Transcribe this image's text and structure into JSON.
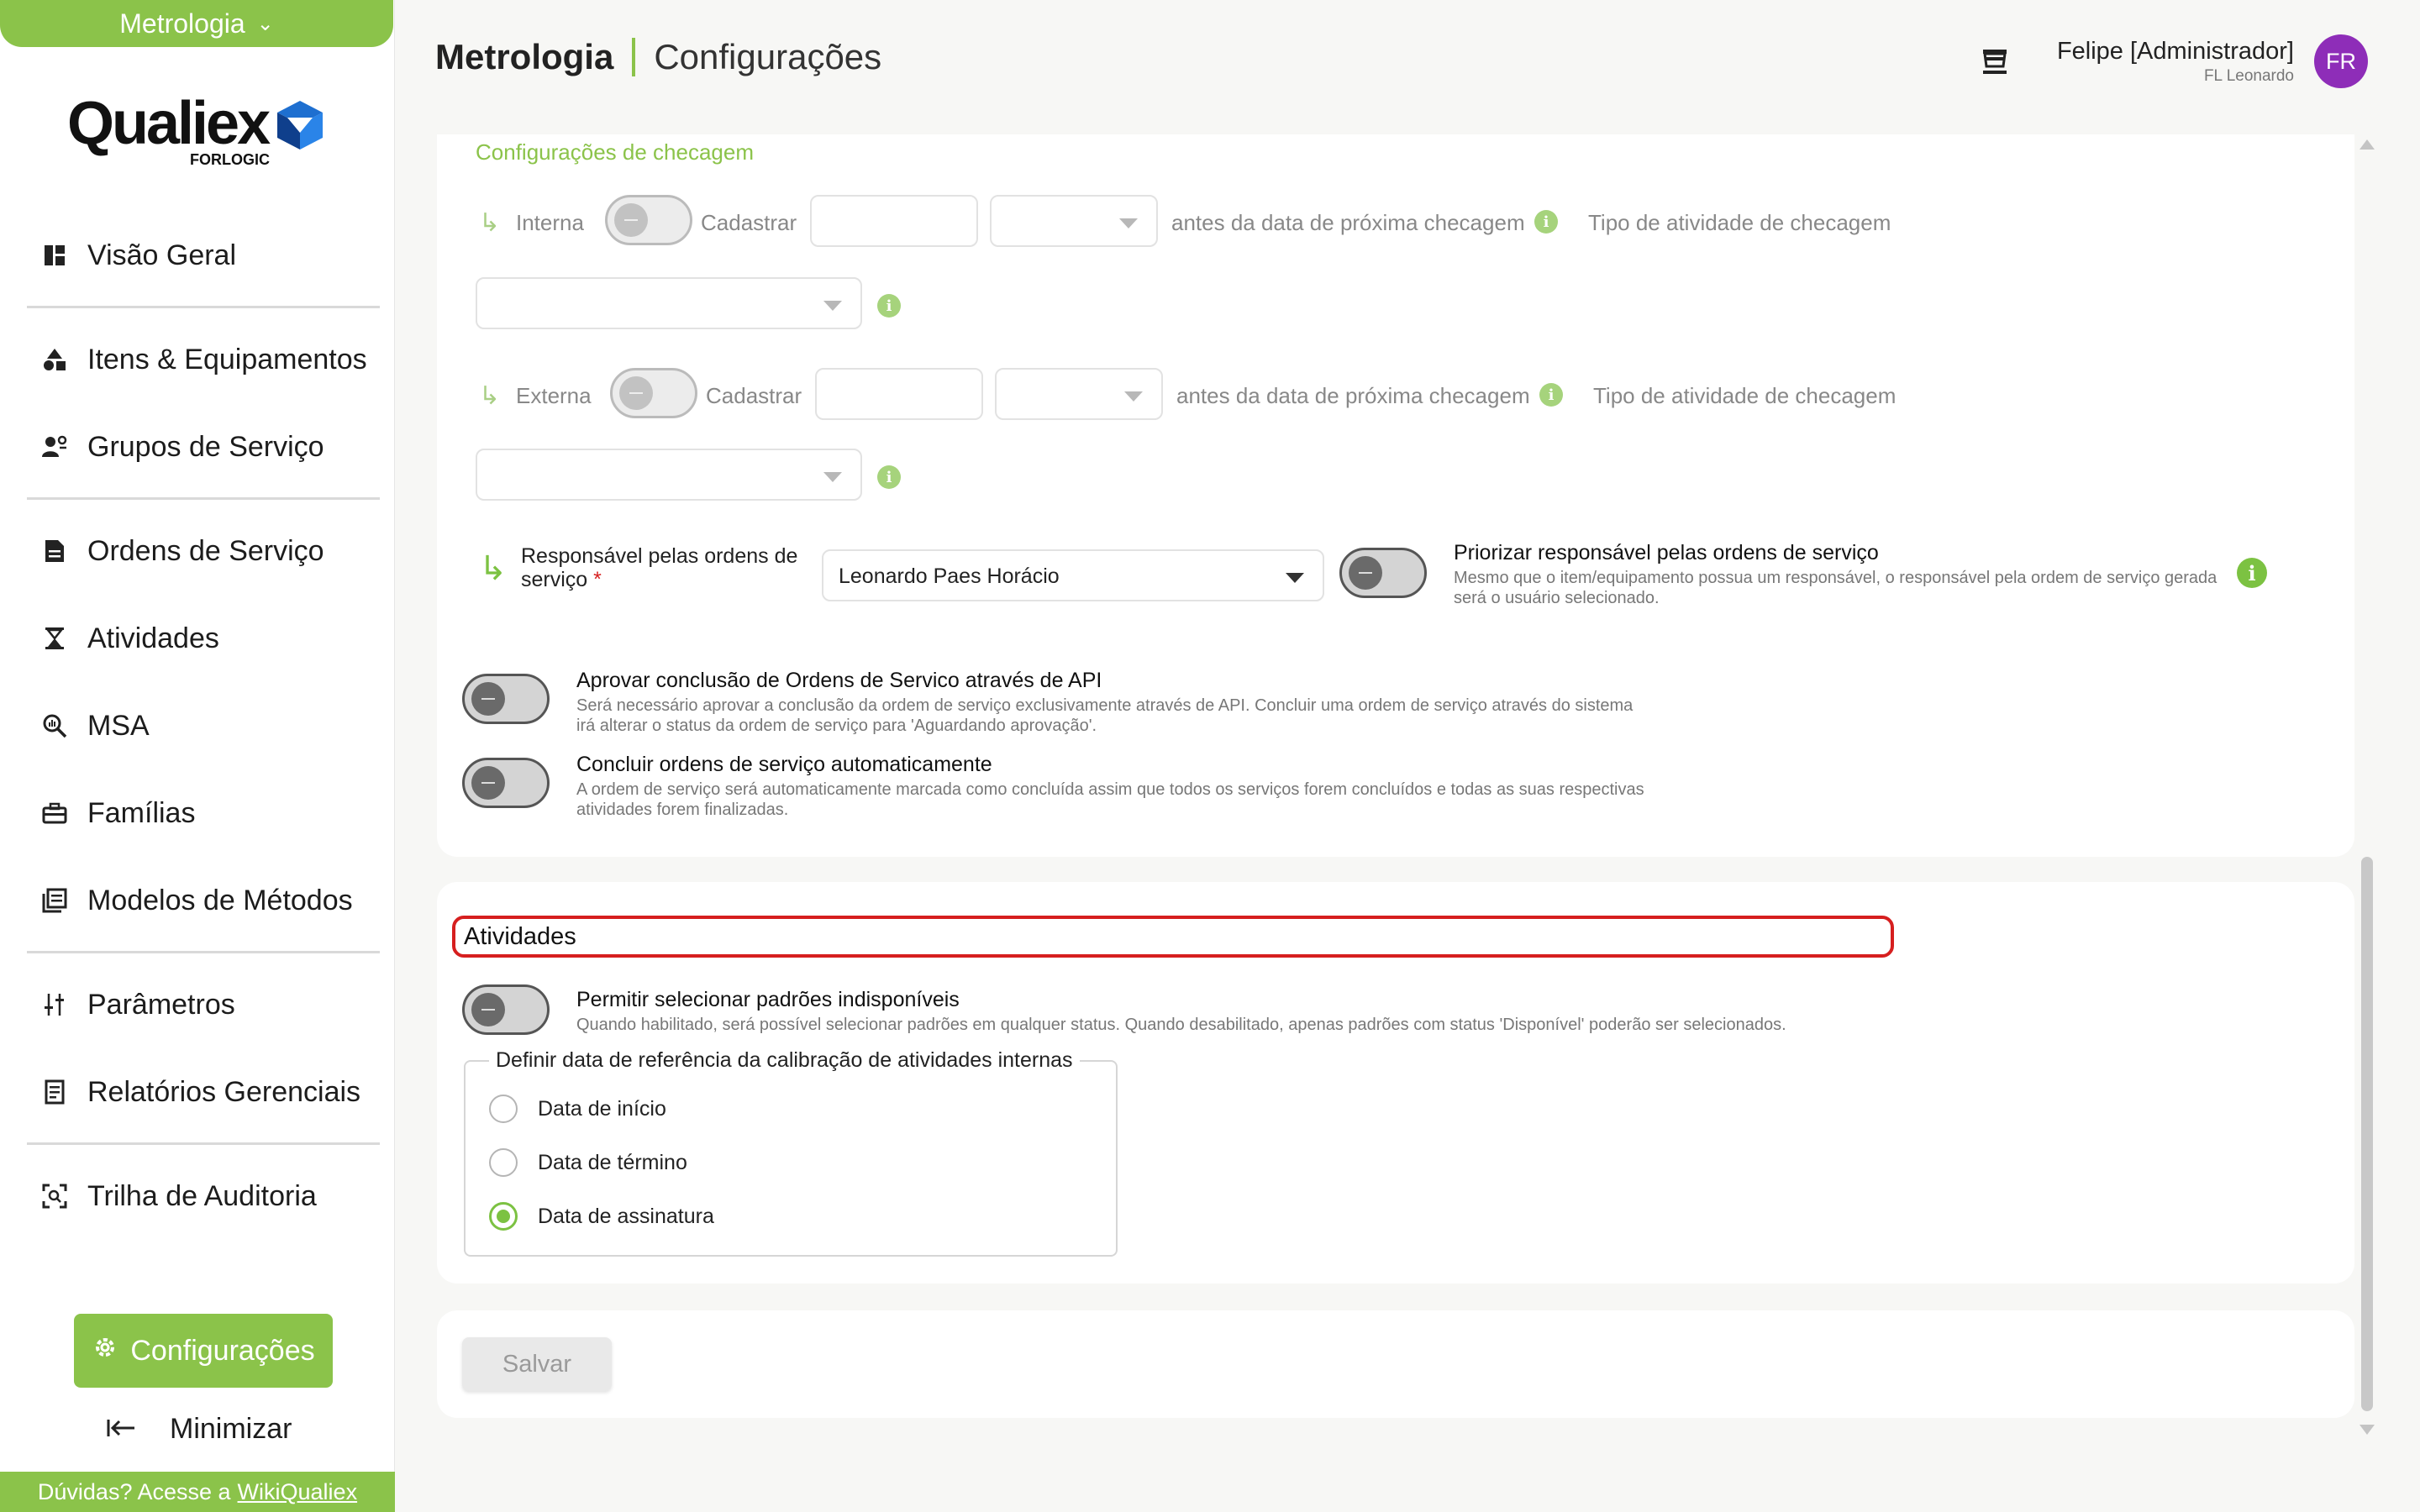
{
  "sidebar": {
    "module": "Metrologia",
    "logo": {
      "name": "Qualiex",
      "sub": "FORLOGIC"
    },
    "items": [
      {
        "label": "Visão Geral",
        "icon": "dashboard-icon"
      },
      {
        "label": "Itens & Equipamentos",
        "icon": "shapes-icon"
      },
      {
        "label": "Grupos de Serviço",
        "icon": "group-icon"
      },
      {
        "label": "Ordens de Serviço",
        "icon": "document-icon"
      },
      {
        "label": "Atividades",
        "icon": "hourglass-icon"
      },
      {
        "label": "MSA",
        "icon": "magnify-chart-icon"
      },
      {
        "label": "Famílias",
        "icon": "toolbox-icon"
      },
      {
        "label": "Modelos de Métodos",
        "icon": "library-icon"
      },
      {
        "label": "Parâmetros",
        "icon": "sliders-icon"
      },
      {
        "label": "Relatórios Gerenciais",
        "icon": "report-icon"
      },
      {
        "label": "Trilha de Auditoria",
        "icon": "audit-icon"
      }
    ],
    "config_label": "Configurações",
    "minimize_label": "Minimizar",
    "help_text": "Dúvidas? Acesse a",
    "help_link": "WikiQualiex"
  },
  "header": {
    "app": "Metrologia",
    "section": "Configurações",
    "user_name": "Felipe [Administrador]",
    "user_org": "FL Leonardo",
    "avatar_initials": "FR",
    "avatar_color": "#8e2db8"
  },
  "checagem": {
    "heading": "Configurações de checagem",
    "interna": {
      "label": "Interna",
      "cadastrar": "Cadastrar",
      "before_text": "antes da data de próxima checagem",
      "activity_type": "Tipo de atividade de checagem"
    },
    "externa": {
      "label": "Externa",
      "cadastrar": "Cadastrar",
      "before_text": "antes da data de próxima checagem",
      "activity_type": "Tipo de atividade de checagem"
    },
    "responsavel": {
      "label": "Responsável pelas ordens de serviço",
      "required_mark": "*",
      "value": "Leonardo Paes Horácio",
      "priority_title": "Priorizar responsável pelas ordens de serviço",
      "priority_desc": "Mesmo que o item/equipamento possua um responsável, o responsável pela ordem de serviço gerada será o usuário selecionado."
    },
    "aprovar": {
      "title": "Aprovar conclusão de Ordens de Servico através de API",
      "desc": "Será necessário aprovar a conclusão da ordem de serviço exclusivamente através de API. Concluir uma ordem de serviço através do sistema irá alterar o status da ordem de serviço para 'Aguardando aprovação'."
    },
    "concluir": {
      "title": "Concluir ordens de serviço automaticamente",
      "desc": "A ordem de serviço será automaticamente marcada como concluída assim que todos os serviços forem concluídos e todas as suas respectivas atividades forem finalizadas."
    }
  },
  "atividades": {
    "title": "Atividades",
    "permitir_title": "Permitir selecionar padrões indisponíveis",
    "permitir_desc": "Quando habilitado, será possível selecionar padrões em qualquer status. Quando desabilitado, apenas padrões com status 'Disponível' poderão ser selecionados.",
    "refdate_legend": "Definir data de referência da calibração de atividades internas",
    "options": [
      "Data de início",
      "Data de término",
      "Data de assinatura"
    ],
    "selected": "Data de assinatura"
  },
  "footer": {
    "save_label": "Salvar"
  },
  "colors": {
    "accent": "#8bc34a",
    "highlight_border": "#d61f1f"
  }
}
